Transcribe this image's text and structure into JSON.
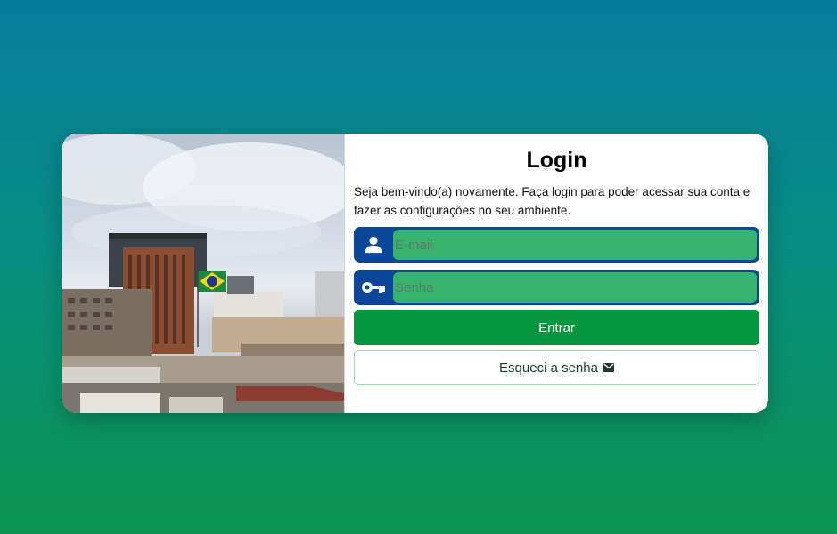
{
  "login": {
    "title": "Login",
    "intro": "Seja bem-vindo(a) novamente. Faça login para poder acessar sua conta e fazer as configurações no seu ambiente.",
    "email": {
      "placeholder": "E-mail",
      "value": "",
      "icon": "user-icon"
    },
    "password": {
      "placeholder": "Senha",
      "value": "",
      "icon": "key-icon"
    },
    "submit_label": "Entrar",
    "forgot_label": "Esqueci a senha",
    "forgot_icon": "envelope-icon"
  },
  "colors": {
    "accent_green": "#06963f",
    "input_green": "#37b36d",
    "icon_blue": "#0b4699"
  },
  "image": {
    "subject": "city-buildings-with-brazil-flag"
  }
}
